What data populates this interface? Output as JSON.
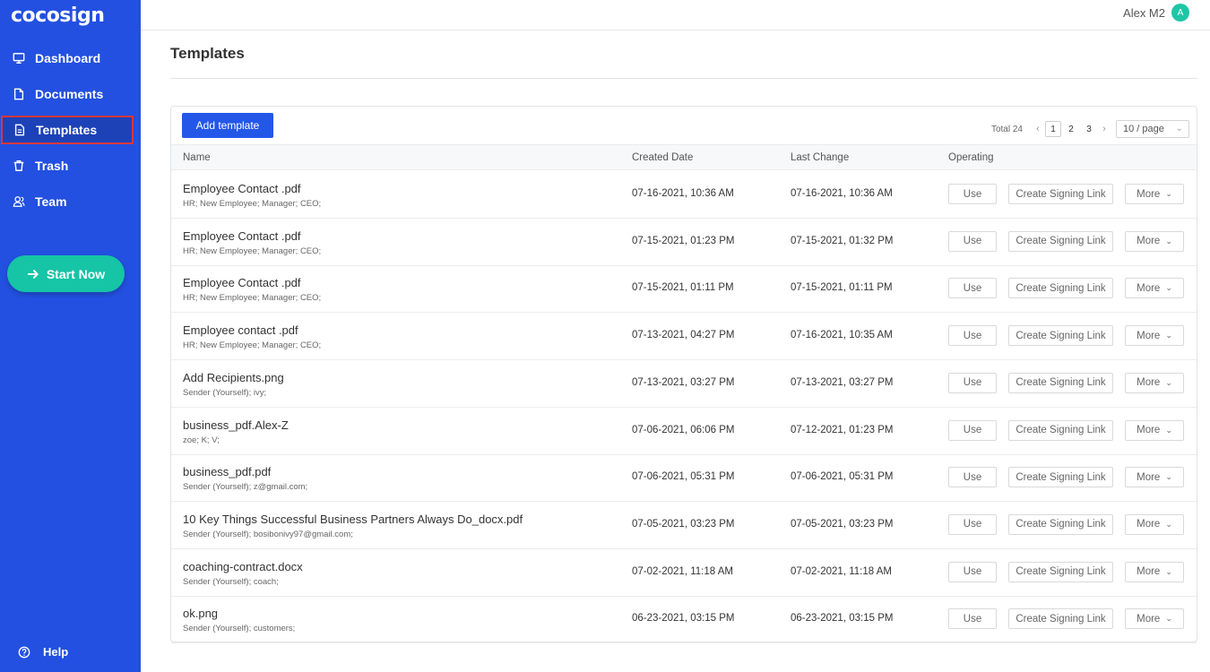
{
  "app": {
    "logo": "cocosign"
  },
  "sidebar": {
    "items": [
      {
        "label": "Dashboard",
        "icon": "monitor-icon"
      },
      {
        "label": "Documents",
        "icon": "document-icon"
      },
      {
        "label": "Templates",
        "icon": "template-icon",
        "active": true
      },
      {
        "label": "Trash",
        "icon": "trash-icon"
      },
      {
        "label": "Team",
        "icon": "team-icon"
      }
    ],
    "start_label": "Start Now",
    "help_label": "Help"
  },
  "header": {
    "user_name": "Alex M2",
    "avatar_letter": "A"
  },
  "page": {
    "title": "Templates"
  },
  "toolbar": {
    "add_label": "Add template"
  },
  "pagination": {
    "total": "Total 24",
    "pages": [
      "1",
      "2",
      "3"
    ],
    "current": "1",
    "page_size": "10 / page"
  },
  "table": {
    "columns": [
      "Name",
      "Created Date",
      "Last Change",
      "Operating"
    ],
    "actions": {
      "use": "Use",
      "link": "Create Signing Link",
      "more": "More"
    },
    "rows": [
      {
        "name": "Employee Contact .pdf",
        "tags": "HR;   New Employee;   Manager;   CEO;",
        "created": "07-16-2021, 10:36 AM",
        "changed": "07-16-2021, 10:36 AM"
      },
      {
        "name": "Employee Contact .pdf",
        "tags": "HR;   New Employee;   Manager;   CEO;",
        "created": "07-15-2021, 01:23 PM",
        "changed": "07-15-2021, 01:32 PM"
      },
      {
        "name": "Employee Contact .pdf",
        "tags": "HR;   New Employee;   Manager;   CEO;",
        "created": "07-15-2021, 01:11 PM",
        "changed": "07-15-2021, 01:11 PM"
      },
      {
        "name": "Employee contact .pdf",
        "tags": "HR;   New Employee;   Manager;   CEO;",
        "created": "07-13-2021, 04:27 PM",
        "changed": "07-16-2021, 10:35 AM"
      },
      {
        "name": "Add Recipients.png",
        "tags": "Sender (Yourself);   ivy;",
        "created": "07-13-2021, 03:27 PM",
        "changed": "07-13-2021, 03:27 PM"
      },
      {
        "name": "business_pdf.Alex-Z",
        "tags": "zoe;   K;   V;",
        "created": "07-06-2021, 06:06 PM",
        "changed": "07-12-2021, 01:23 PM"
      },
      {
        "name": "business_pdf.pdf",
        "tags": "Sender (Yourself);   z@gmail.com;",
        "created": "07-06-2021, 05:31 PM",
        "changed": "07-06-2021, 05:31 PM"
      },
      {
        "name": "10 Key Things Successful Business Partners Always Do_docx.pdf",
        "tags": "Sender (Yourself);   bosibonivy97@gmail.com;",
        "created": "07-05-2021, 03:23 PM",
        "changed": "07-05-2021, 03:23 PM"
      },
      {
        "name": "coaching-contract.docx",
        "tags": "Sender (Yourself);   coach;",
        "created": "07-02-2021, 11:18 AM",
        "changed": "07-02-2021, 11:18 AM"
      },
      {
        "name": "ok.png",
        "tags": "Sender (Yourself);   customers;",
        "created": "06-23-2021, 03:15 PM",
        "changed": "06-23-2021, 03:15 PM"
      }
    ]
  },
  "colors": {
    "sidebar": "#2350e0",
    "accent": "#2357e8",
    "start": "#16c4a6",
    "active_border": "#d9373c"
  }
}
